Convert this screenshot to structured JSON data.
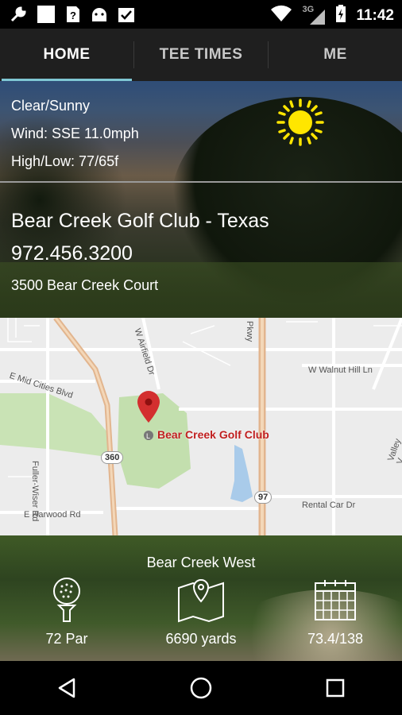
{
  "status_bar": {
    "time": "11:42",
    "network": "3G",
    "left_icons": [
      "wrench-icon",
      "square-icon",
      "sim-unknown-icon",
      "android-icon",
      "checklist-icon"
    ],
    "right_icons": [
      "wifi-icon",
      "signal-icon",
      "battery-charging-icon"
    ]
  },
  "tabs": [
    {
      "label": "HOME",
      "active": true
    },
    {
      "label": "TEE TIMES",
      "active": false
    },
    {
      "label": "ME",
      "active": false
    }
  ],
  "weather": {
    "condition": "Clear/Sunny",
    "wind": "Wind: SSE 11.0mph",
    "high_low": "High/Low: 77/65f",
    "icon": "sun-icon"
  },
  "club": {
    "name": "Bear Creek Golf Club - Texas",
    "phone": "972.456.3200",
    "address": "3500 Bear Creek Court"
  },
  "map": {
    "pin_label": "Bear Creek Golf Club",
    "street_labels": {
      "mid_cities": "E Mid Cities Blvd",
      "fuller_wiser": "Fuller-Wiser Rd",
      "harwood": "E Harwood Rd",
      "airfield": "W Airfield Dr",
      "walnut_hill": "W Walnut Hill Ln",
      "rental_car": "Rental Car Dr",
      "valley": "Valley V",
      "pkwy": "Pkwy"
    },
    "shields": {
      "hwy360": "360",
      "hwy97": "97"
    }
  },
  "course": {
    "name": "Bear Creek West",
    "par": "72 Par",
    "yards": "6690 yards",
    "rating": "73.4/138"
  },
  "nav": [
    "back-icon",
    "home-icon",
    "recents-icon"
  ],
  "colors": {
    "accent": "#7fc7d3",
    "pin": "#d32f2f"
  }
}
